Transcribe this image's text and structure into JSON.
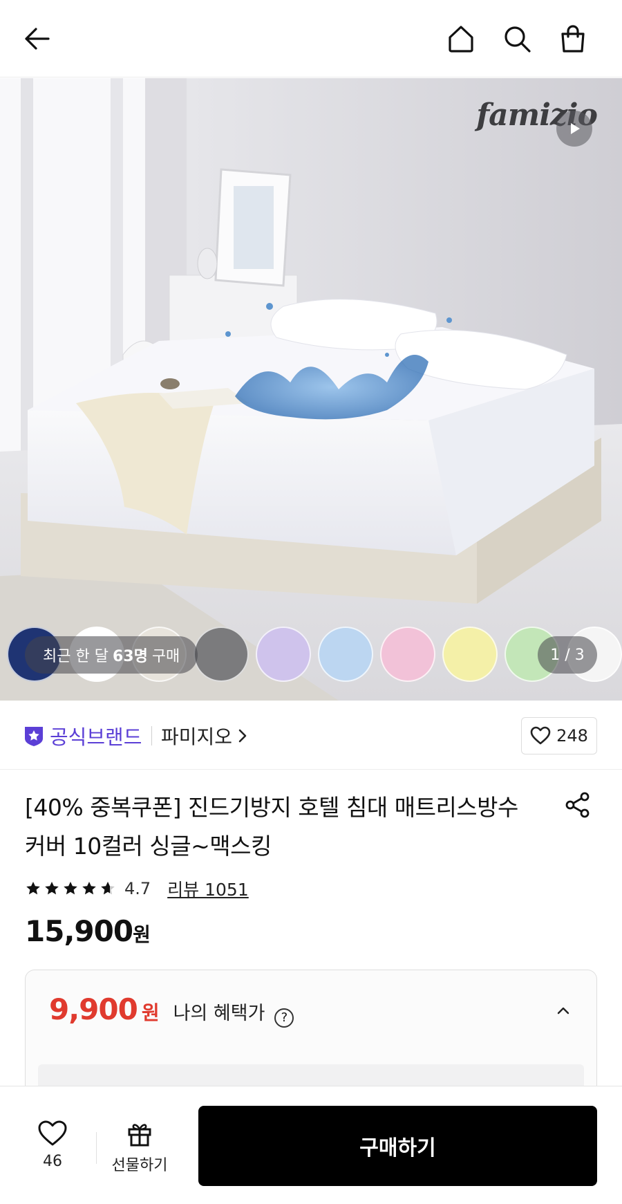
{
  "header": {
    "back_icon": "arrow-left-icon",
    "home_icon": "home-icon",
    "search_icon": "search-icon",
    "cart_icon": "shopping-bag-icon"
  },
  "hero": {
    "brand_logo": "famizio",
    "play_icon": "play-icon",
    "recent_purchase": {
      "prefix": "최근 한 달",
      "count": "63명",
      "suffix": "구매"
    },
    "image_counter": "1 / 3",
    "color_swatches": [
      "#1f3473",
      "#ffffff",
      "#e8e4dc",
      "#7b7b7d",
      "#cfc3ec",
      "#bcd6f1",
      "#f2c2d8",
      "#f4f0a8",
      "#c3e6b8",
      "#f5f5f5"
    ]
  },
  "brand": {
    "official_label": "공식브랜드",
    "official_icon": "star-badge-icon",
    "brand_name": "파미지오",
    "like_count": "248"
  },
  "product": {
    "title": "[40% 중복쿠폰] 진드기방지 호텔 침대 매트리스방수커버 10컬러 싱글~맥스킹",
    "rating": "4.7",
    "review_label": "리뷰 1051",
    "price": "15,900",
    "price_unit": "원"
  },
  "benefit": {
    "price": "9,900",
    "price_unit": "원",
    "label": "나의 혜택가",
    "help_symbol": "?"
  },
  "bottom_bar": {
    "wish_count": "46",
    "gift_label": "선물하기",
    "buy_label": "구매하기"
  },
  "colors": {
    "brand_purple": "#5b3fd6",
    "benefit_red": "#e03a2e",
    "buy_button": "#000000"
  }
}
